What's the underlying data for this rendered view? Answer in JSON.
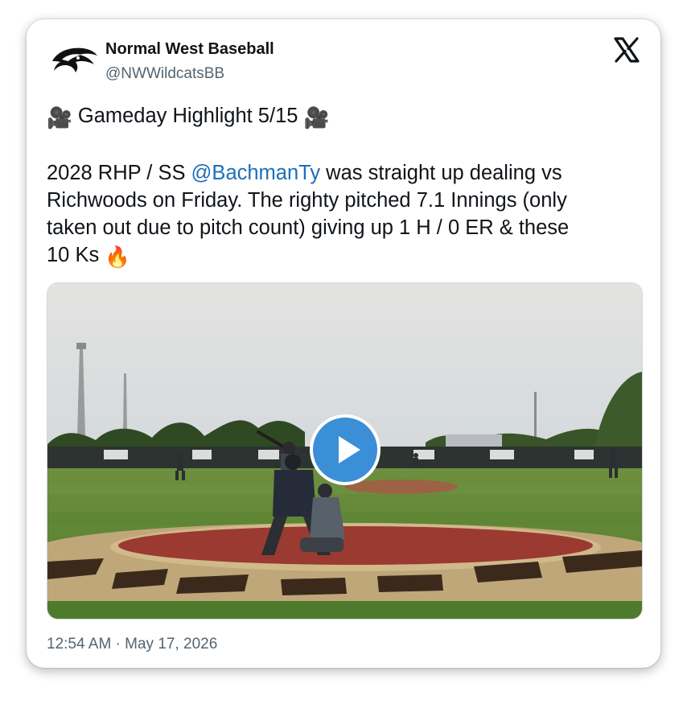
{
  "account": {
    "name": "Normal West Baseball",
    "handle": "@NWWildcatsBB",
    "avatar_icon": "wildcat-logo-icon"
  },
  "brand_icon": "x-logo-icon",
  "post": {
    "headline": {
      "lead_emoji": "🎥",
      "text": "Gameday Highlight 5/15",
      "trail_emoji": "🎥"
    },
    "line1_prefix": "2028 RHP / SS ",
    "mention": "@BachmanTy",
    "line1_suffix": " was straight up dealing vs",
    "line2": "Richwoods on Friday. The righty pitched 7.1 Innings (only",
    "line3": "taken out due to pitch count)  giving up 1 H / 0 ER & these",
    "line4": "10 Ks",
    "line4_emoji": "🔥"
  },
  "media": {
    "type": "video",
    "play_icon": "play-icon",
    "accent_color": "#3a8fd6"
  },
  "timestamp": "12:54 AM · May 17, 2026",
  "colors": {
    "text": "#0f1419",
    "secondary": "#536471",
    "link": "#1d6fb8"
  }
}
